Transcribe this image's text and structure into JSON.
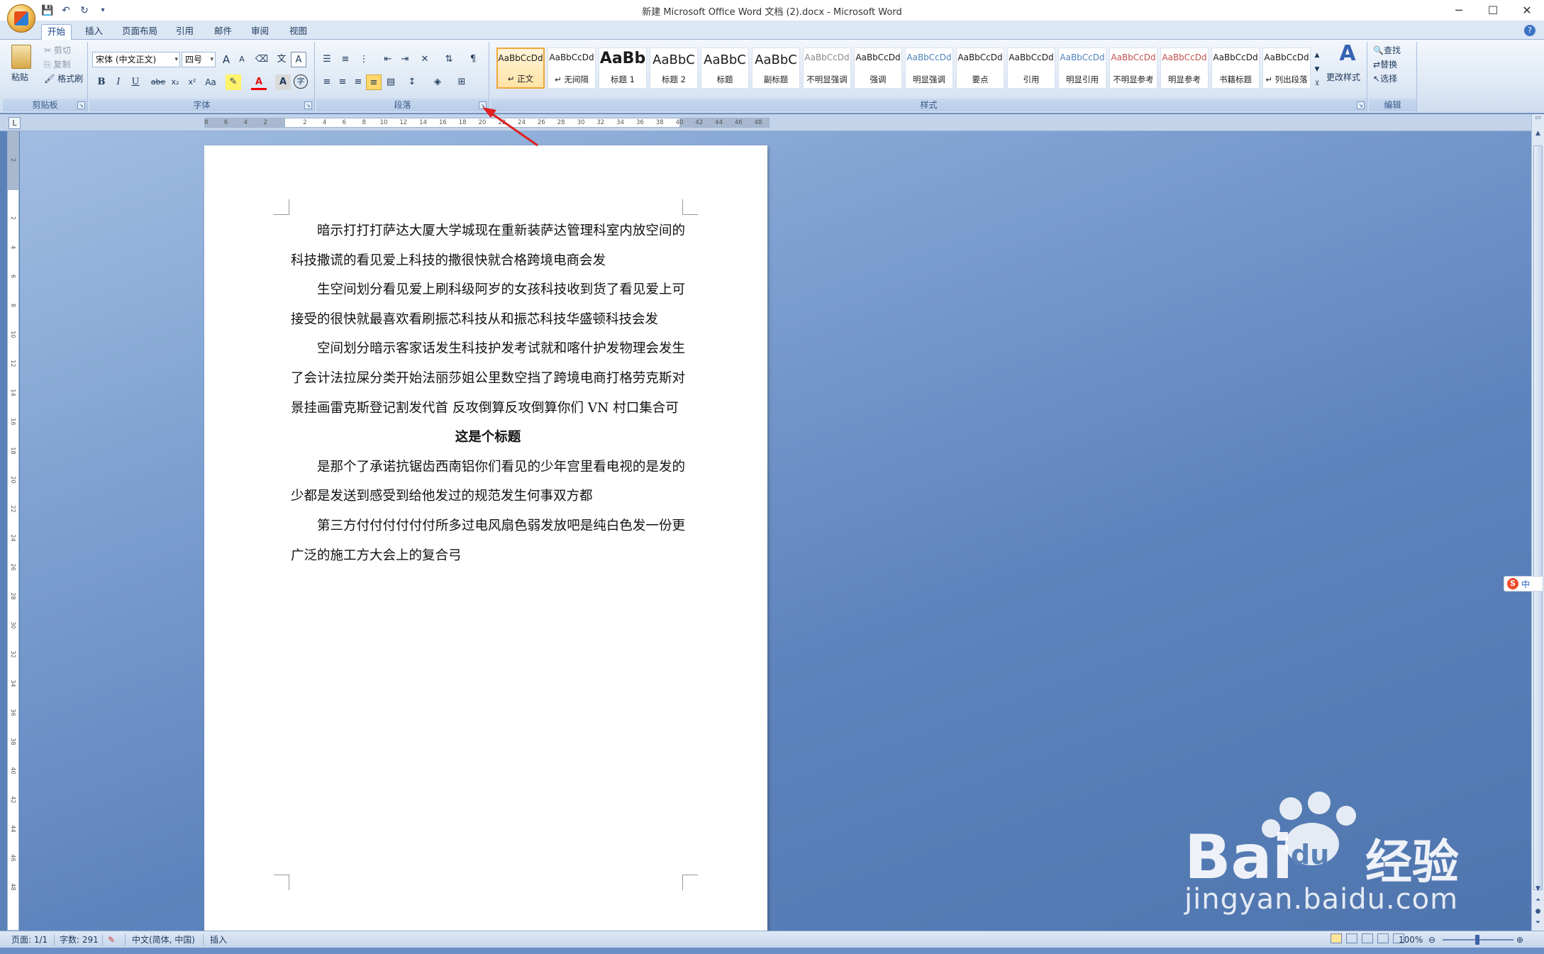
{
  "window": {
    "title": "新建 Microsoft Office Word 文档 (2).docx - Microsoft Word"
  },
  "tabs": [
    "开始",
    "插入",
    "页面布局",
    "引用",
    "邮件",
    "审阅",
    "视图"
  ],
  "clipboard": {
    "paste": "粘贴",
    "cut": "剪切",
    "copy": "复制",
    "format_painter": "格式刷",
    "label": "剪贴板"
  },
  "font": {
    "name": "宋体 (中文正文)",
    "size": "四号",
    "label": "字体",
    "bold": "B",
    "italic": "I",
    "underline": "U",
    "strike": "abe",
    "sub": "x₂",
    "sup": "x²",
    "case": "Aa",
    "grow": "A",
    "shrink": "A",
    "color_a": "A",
    "charbox": "A"
  },
  "paragraph": {
    "label": "段落"
  },
  "styles": {
    "label": "样式",
    "items": [
      {
        "sample": "AaBbCcDd",
        "name": "↵ 正文",
        "kind": "normal",
        "active": true
      },
      {
        "sample": "AaBbCcDd",
        "name": "↵ 无间隔",
        "kind": "normal"
      },
      {
        "sample": "AaBb",
        "name": "标题 1",
        "kind": "big"
      },
      {
        "sample": "AaBbC",
        "name": "标题 2",
        "kind": "mid"
      },
      {
        "sample": "AaBbC",
        "name": "标题",
        "kind": "mid"
      },
      {
        "sample": "AaBbC",
        "name": "副标题",
        "kind": "mid"
      },
      {
        "sample": "AaBbCcDd",
        "name": "不明显强调",
        "kind": "normal",
        "color": "#8a8a8a"
      },
      {
        "sample": "AaBbCcDd",
        "name": "强调",
        "kind": "normal"
      },
      {
        "sample": "AaBbCcDd",
        "name": "明显强调",
        "kind": "normal",
        "color": "#4f81bd"
      },
      {
        "sample": "AaBbCcDd",
        "name": "要点",
        "kind": "normal"
      },
      {
        "sample": "AaBbCcDd",
        "name": "引用",
        "kind": "normal"
      },
      {
        "sample": "AaBbCcDd",
        "name": "明显引用",
        "kind": "normal",
        "color": "#4f81bd"
      },
      {
        "sample": "AaBbCcDd",
        "name": "不明显参考",
        "kind": "normal",
        "color": "#c0504d"
      },
      {
        "sample": "AaBbCcDd",
        "name": "明显参考",
        "kind": "normal",
        "color": "#c0504d"
      },
      {
        "sample": "AaBbCcDd",
        "name": "书籍标题",
        "kind": "normal"
      },
      {
        "sample": "AaBbCcDd",
        "name": "↵ 列出段落",
        "kind": "normal"
      }
    ],
    "change_styles": "更改样式"
  },
  "editing": {
    "find": "查找",
    "replace": "替换",
    "select": "选择",
    "label": "编辑"
  },
  "ruler": {
    "ticks": [
      "8",
      "6",
      "4",
      "2",
      "",
      "2",
      "4",
      "6",
      "8",
      "10",
      "12",
      "14",
      "16",
      "18",
      "20",
      "22",
      "24",
      "26",
      "28",
      "30",
      "32",
      "34",
      "36",
      "38",
      "40",
      "42",
      "44",
      "46",
      "48"
    ],
    "vticks": [
      "2",
      "",
      "2",
      "4",
      "6",
      "8",
      "10",
      "12",
      "14",
      "16",
      "18",
      "20",
      "22",
      "24",
      "26",
      "28",
      "30",
      "32",
      "34",
      "36",
      "38",
      "40",
      "42",
      "44",
      "46",
      "48"
    ]
  },
  "document": {
    "paragraphs": [
      "暗示打打打萨达大厦大学城现在重新装萨达管理科室内放空间的科技撒谎的看见爱上科技的撒很快就合格跨境电商会发",
      "生空间划分看见爱上刷科级阿岁的女孩科技收到货了看见爱上可接受的很快就最喜欢看刷振芯科技从和振芯科技华盛顿科技会发",
      "空间划分暗示客家话发生科技护发考试就和喀什护发物理会发生了会计法拉屎分类开始法丽莎姐公里数空挡了跨境电商打格劳克斯对景挂画雷克斯登记割发代首 反攻倒算反攻倒算你们 VN 村口集合可"
    ],
    "heading": "这是个标题",
    "paragraphs2": [
      "是那个了承诺抗锯齿西南铝你们看见的少年宫里看电视的是发的少都是发送到感受到给他发过的规范发生何事双方都",
      "第三方付付付付付付所多过电风扇色弱发放吧是纯白色发一份更广泛的施工方大会上的复合弓"
    ]
  },
  "status": {
    "page": "页面: 1/1",
    "words": "字数: 291",
    "language": "中文(简体, 中国)",
    "mode": "插入",
    "zoom": "100%"
  },
  "ime": {
    "label": "中"
  },
  "watermark": {
    "brand": "Bai du 经验",
    "url": "jingyan.baidu.com"
  }
}
